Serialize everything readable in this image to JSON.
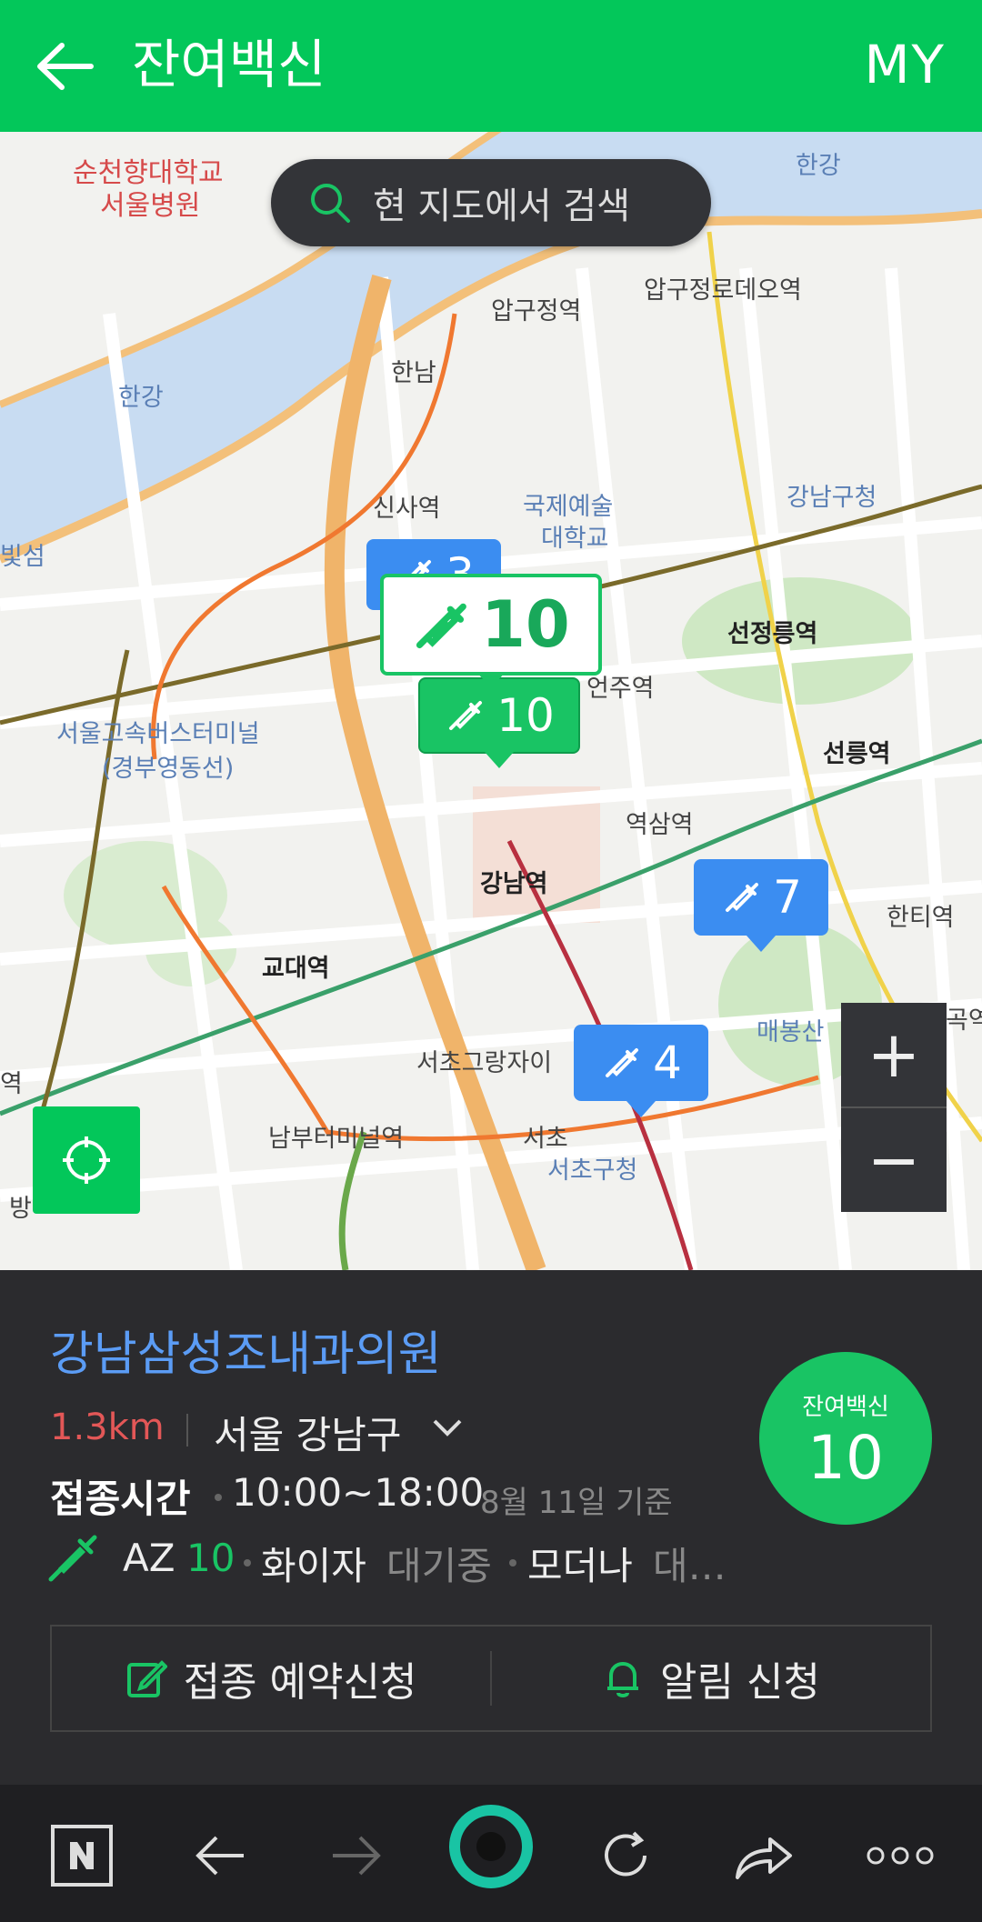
{
  "header": {
    "title": "잔여백신",
    "my_label": "MY",
    "back_icon": "arrow-left-icon"
  },
  "search": {
    "label": "현 지도에서 검색"
  },
  "map": {
    "labels": [
      {
        "text": "순천향대학교",
        "cls": "red"
      },
      {
        "text": "서울병원",
        "cls": "red"
      },
      {
        "text": "한강",
        "cls": "blue"
      },
      {
        "text": "한강",
        "cls": "blue"
      },
      {
        "text": "압구정역",
        "cls": ""
      },
      {
        "text": "압구정로데오역",
        "cls": ""
      },
      {
        "text": "한남",
        "cls": ""
      },
      {
        "text": "신사역",
        "cls": ""
      },
      {
        "text": "국제예술",
        "cls": "blue"
      },
      {
        "text": "대학교",
        "cls": "blue"
      },
      {
        "text": "강남구청",
        "cls": "blue"
      },
      {
        "text": "빛섬",
        "cls": "blue"
      },
      {
        "text": "선정릉역",
        "cls": "bold"
      },
      {
        "text": "언주역",
        "cls": ""
      },
      {
        "text": "서울고속버스터미널",
        "cls": "blue"
      },
      {
        "text": "(경부영동선)",
        "cls": "blue"
      },
      {
        "text": "선릉역",
        "cls": "bold"
      },
      {
        "text": "역삼역",
        "cls": ""
      },
      {
        "text": "강남역",
        "cls": "bold"
      },
      {
        "text": "한티역",
        "cls": ""
      },
      {
        "text": "교대역",
        "cls": "bold"
      },
      {
        "text": "매봉산",
        "cls": "blue"
      },
      {
        "text": "서초그랑자이",
        "cls": ""
      },
      {
        "text": "남부터미널역",
        "cls": ""
      },
      {
        "text": "서초",
        "cls": ""
      },
      {
        "text": "서초구청",
        "cls": "blue"
      },
      {
        "text": "곡역",
        "cls": ""
      },
      {
        "text": "방",
        "cls": ""
      },
      {
        "text": "역",
        "cls": ""
      }
    ],
    "markers": [
      {
        "count": "3",
        "style": "blue"
      },
      {
        "count": "10",
        "style": "green"
      },
      {
        "count": "10",
        "style": "selected"
      },
      {
        "count": "7",
        "style": "blue"
      },
      {
        "count": "4",
        "style": "blue"
      }
    ],
    "zoom_in": "+",
    "zoom_out": "−"
  },
  "panel": {
    "name": "강남삼성조내과의원",
    "distance": "1.3km",
    "region": "서울 강남구",
    "hours_label": "접종시간",
    "hours": "10:00~18:00",
    "as_of": "8월 11일 기준",
    "vaccines": {
      "az_label": "AZ",
      "az_count": "10",
      "pfizer_label": "화이자",
      "pfizer_status": "대기중",
      "moderna_label": "모더나",
      "moderna_status": "대…"
    },
    "badge_label": "잔여백신",
    "badge_count": "10",
    "reserve_label": "접종 예약신청",
    "alert_label": "알림 신청"
  },
  "colors": {
    "accent": "#03c75a",
    "marker_blue": "#3b8df1",
    "name_blue": "#5b9cf5",
    "distance_red": "#e35757"
  }
}
